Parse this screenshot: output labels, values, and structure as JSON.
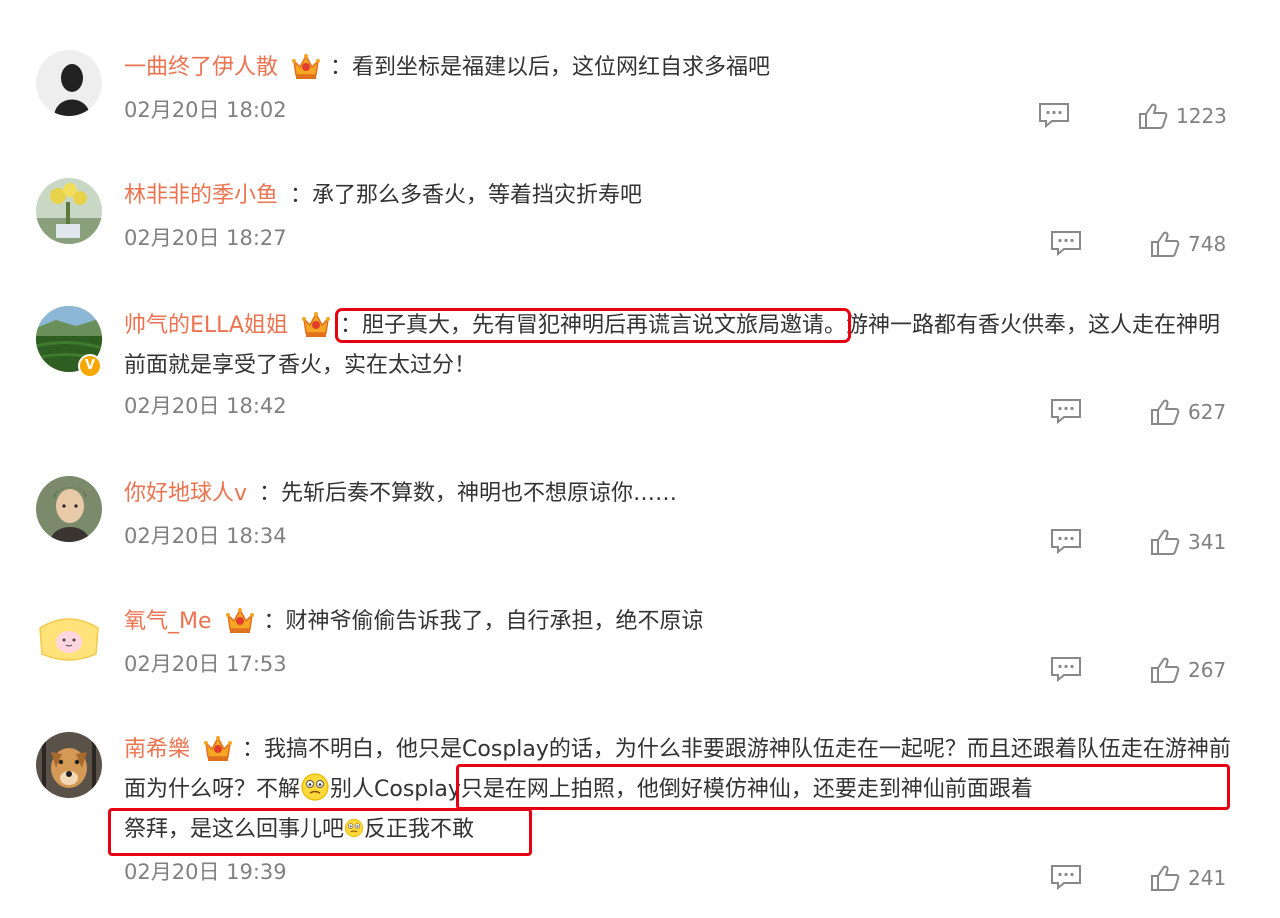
{
  "comments": [
    {
      "user": "一曲终了伊人散",
      "separator": "：",
      "text": "看到坐标是福建以后，这位网红自求多福吧",
      "time": "02月20日 18:02",
      "likes": "1223"
    },
    {
      "user": "林非非的季小鱼",
      "separator": "：",
      "text": "承了那么多香火，等着挡灾折寿吧",
      "time": "02月20日 18:27",
      "likes": "748"
    },
    {
      "user": "帅气的ELLA姐姐",
      "separator": "：",
      "text_highlight": "胆子真大，先有冒犯神明后再谎言说文旅局邀请。",
      "text_rest": "游神一路都有香火供奉，这人走在神明前面就是享受了香火，实在太过分！",
      "time": "02月20日 18:42",
      "likes": "627",
      "verified_badge": "V"
    },
    {
      "user": "你好地球人v",
      "separator": "：",
      "text": "先斩后奏不算数，神明也不想原谅你……",
      "time": "02月20日 18:34",
      "likes": "341"
    },
    {
      "user": "氧气_Me",
      "separator": "：",
      "text": "财神爷偷偷告诉我了，自行承担，绝不原谅",
      "time": "02月20日 17:53",
      "likes": "267"
    },
    {
      "user": "南希樂",
      "separator": "：",
      "text_a": "我搞不明白，他只是Cosplay的话，为什么非要跟游神队伍走在一起呢？而且还跟着队伍走在游神前面为什么呀？不解",
      "text_b": "别人Cosplay只是在网上拍照，他倒好模仿神仙，还要走到神仙前面跟着",
      "text_c": "祭拜，是这么回事儿吧",
      "text_d": "反正我不敢",
      "time": "02月20日 19:39",
      "likes": "241"
    }
  ],
  "icons": {
    "crown": "vip-crown-icon",
    "reply": "comment-reply-icon",
    "like": "thumbs-up-icon",
    "emoji": "thinking-emoji-icon"
  },
  "colors": {
    "username": "#eb7350",
    "highlight_box": "#e60012",
    "meta": "#808080"
  }
}
